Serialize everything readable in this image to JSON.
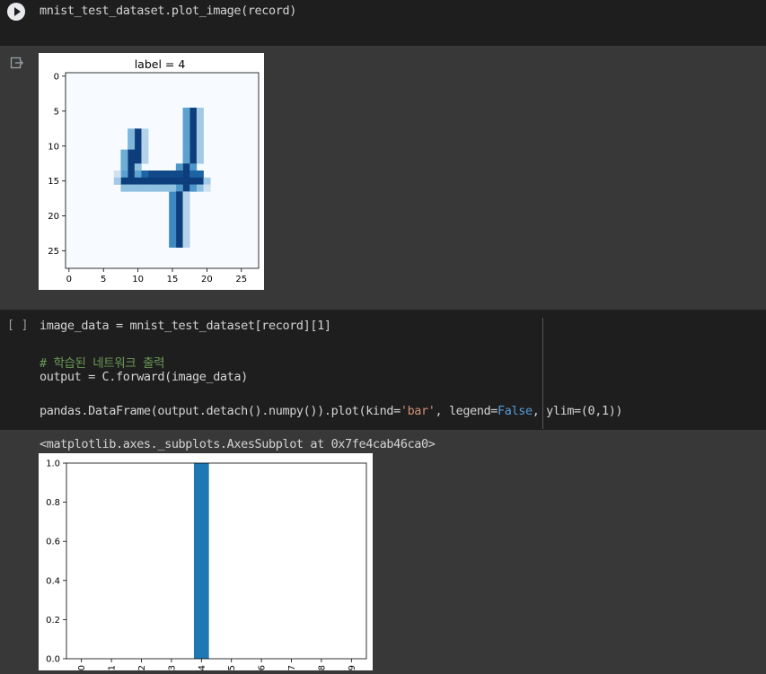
{
  "cells": [
    {
      "code": "mnist_test_dataset.plot_image(record)",
      "output_plot": {
        "title": "label = 4",
        "x_ticks": [
          "0",
          "5",
          "10",
          "15",
          "20",
          "25"
        ],
        "y_ticks": [
          "0",
          "5",
          "10",
          "15",
          "20",
          "25"
        ],
        "colormap": "Blues"
      }
    },
    {
      "exec_count": "[ ]",
      "code_line1": "image_data = mnist_test_dataset[record][1]",
      "comment": "# 학습된 네트워크 출력",
      "code_line2": "output = C.forward(image_data)",
      "code_line3_pre": "pandas.DataFrame(output.detach().numpy()).plot(kind=",
      "code_line3_str": "'bar'",
      "code_line3_mid": ", legend=",
      "code_line3_kw": "False",
      "code_line3_post": ", ylim=(0,1))",
      "output_text": "<matplotlib.axes._subplots.AxesSubplot at 0x7fe4cab46ca0>"
    }
  ],
  "chart_data": {
    "type": "bar",
    "categories": [
      "0",
      "1",
      "2",
      "3",
      "4",
      "5",
      "6",
      "7",
      "8",
      "9"
    ],
    "values": [
      0,
      0,
      0,
      0,
      1.0,
      0,
      0,
      0,
      0,
      0
    ],
    "title": "",
    "xlabel": "",
    "ylabel": "",
    "ylim": [
      0,
      1
    ],
    "y_ticks": [
      "0.0",
      "0.2",
      "0.4",
      "0.6",
      "0.8",
      "1.0"
    ],
    "bar_color": "#1f77b4",
    "legend": false
  },
  "theme": {
    "code_bg": "#1e1e1e",
    "output_bg": "#383838",
    "code_text": "#d4d4d4",
    "comment": "#6a9955",
    "string": "#ce9178",
    "keyword": "#569cd6"
  }
}
